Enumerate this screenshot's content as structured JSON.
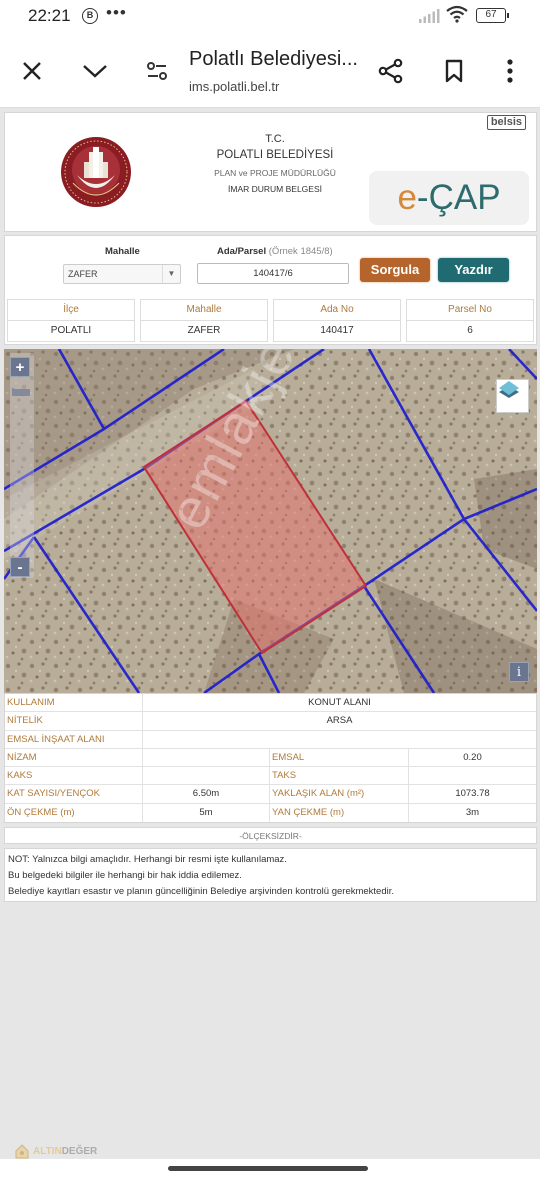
{
  "status_bar": {
    "time": "22:21",
    "notification_icon": "B",
    "more": "•••",
    "battery": "67"
  },
  "browser": {
    "title": "Polatlı Belediyesi...",
    "url": "ims.polatli.bel.tr",
    "icons": [
      "close-icon",
      "chevron-down-icon",
      "page-settings-icon",
      "share-icon",
      "bookmark-icon",
      "more-vert-icon"
    ]
  },
  "header": {
    "tc": "T.C.",
    "municipality": "POLATLI BELEDİYESİ",
    "department": "PLAN ve PROJE MÜDÜRLÜĞÜ",
    "document": "İMAR DURUM BELGESİ",
    "badge": "belsis",
    "ecap_prefix": "e",
    "ecap_suffix": "-ÇAP"
  },
  "search": {
    "mahalle_label": "Mahalle",
    "mahalle_value": "ZAFER",
    "ada_parsel_label": "Ada/Parsel",
    "ada_parsel_hint": "(Örnek 1845/8)",
    "ada_parsel_value": "140417/6",
    "sorgula_label": "Sorgula",
    "yazdir_label": "Yazdır"
  },
  "parcel_info": [
    {
      "header": "İlçe",
      "value": "POLATLI"
    },
    {
      "header": "Mahalle",
      "value": "ZAFER"
    },
    {
      "header": "Ada No",
      "value": "140417"
    },
    {
      "header": "Parsel No",
      "value": "6"
    }
  ],
  "map": {
    "zoom_in": "+",
    "zoom_out": "-",
    "info": "i",
    "watermark": "emlakjet.com",
    "colors": {
      "parcel_fill": "#e8706a",
      "parcel_stroke": "#c0303a",
      "grid": "#1a1ad0"
    }
  },
  "details": {
    "kullanim": {
      "label": "KULLANIM",
      "value": "KONUT ALANI"
    },
    "nitelik": {
      "label": "NİTELİK",
      "value": "ARSA"
    },
    "emsal_insaat": {
      "label": "EMSAL İNŞAAT ALANI",
      "value": ""
    },
    "rows": [
      {
        "k1": "NİZAM",
        "v1": "",
        "k2": "EMSAL",
        "v2": "0.20"
      },
      {
        "k1": "KAKS",
        "v1": "",
        "k2": "TAKS",
        "v2": ""
      },
      {
        "k1": "KAT SAYISI/YENÇOK",
        "v1": "6.50m",
        "k2": "YAKLAŞIK ALAN (m²)",
        "v2": "1073.78"
      },
      {
        "k1": "ÖN ÇEKME (m)",
        "v1": "5m",
        "k2": "YAN ÇEKME (m)",
        "v2": "3m"
      }
    ]
  },
  "scale_note": "-ÖLÇEKSİZDİR-",
  "notes": [
    "NOT: Yalnızca bilgi amaçlıdır. Herhangi bir resmi işte kullanılamaz.",
    "Bu belgedeki bilgiler ile herhangi bir hak iddia edilemez.",
    "Belediye kayıtları esastır ve planın güncelliğinin Belediye arşivinden kontrolü gerekmektedir."
  ],
  "brand": {
    "part1": "ALTIN",
    "part2": "DEĞER"
  }
}
